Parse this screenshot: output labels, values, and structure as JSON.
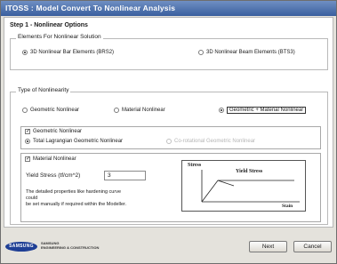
{
  "window": {
    "title": "ITOSS : Model Convert To Nonlinear Analysis"
  },
  "step": {
    "title": "Step 1 - Nonlinear Options"
  },
  "elements_group": {
    "label": "Elements For Nonlinear Solution",
    "options": [
      "3D Nonlinear Bar Elements (BRS2)",
      "3D Nonlinear Beam Elements (BTS3)"
    ],
    "selected": "3D Nonlinear Bar Elements (BRS2)"
  },
  "nonlinearity_group": {
    "label": "Type of Nonlinearity",
    "options": [
      "Geometric Nonlinear",
      "Material Nonlinear",
      "Geometric + Material Nonlinear"
    ],
    "selected": "Geometric + Material Nonlinear"
  },
  "geometric_panel": {
    "checkbox_label": "Geometric Nonlinear",
    "checked": true,
    "options": [
      "Total Lagrangian Geometric Nonlinear",
      "Co-rotational Geometric Nonlinear"
    ],
    "selected": "Total Lagrangian Geometric Nonlinear"
  },
  "material_panel": {
    "checkbox_label": "Material Nonlinear",
    "checked": true,
    "yield_label": "Yield Stress (tf/cm^2)",
    "yield_value": "3",
    "note_line1": "The detailed properties like hardening curve could",
    "note_line2": "be set manually if required within the Modeller.",
    "diagram": {
      "stress_label": "Stress",
      "yield_label": "Yield Stress",
      "strain_label": "Stain"
    }
  },
  "footer": {
    "logo_text": "SAMSUNG",
    "company_line1": "SAMSUNG",
    "company_line2": "ENGINEERING & CONSTRUCTION",
    "next_label": "Next",
    "cancel_label": "Cancel"
  },
  "colors": {
    "title_bar": "#3a5f9e",
    "window_bg": "#e4e2dc",
    "logo_blue": "#1f3f95"
  }
}
